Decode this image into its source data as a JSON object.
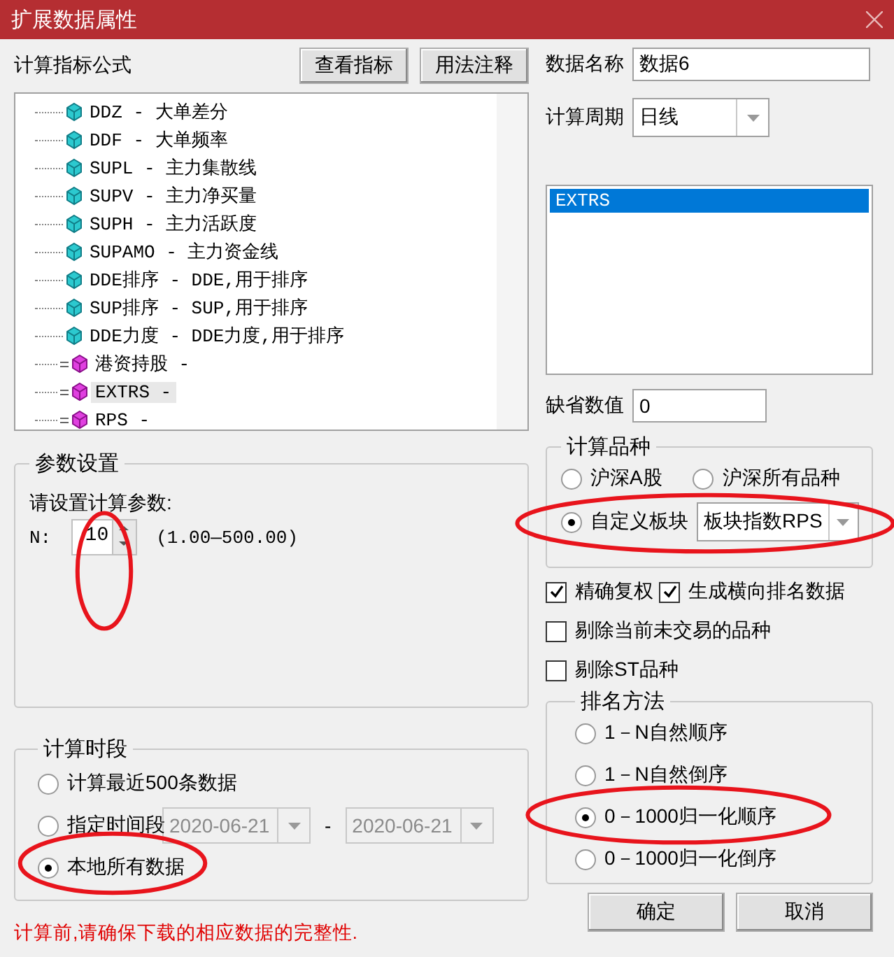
{
  "window": {
    "title": "扩展数据属性"
  },
  "formula": {
    "label": "计算指标公式",
    "buttons": [
      "查看指标",
      "用法注释"
    ],
    "tree": [
      {
        "kind": "formula",
        "text": "DDZ - 大单差分",
        "selected": false
      },
      {
        "kind": "formula",
        "text": "DDF - 大单频率",
        "selected": false
      },
      {
        "kind": "formula",
        "text": "SUPL - 主力集散线",
        "selected": false
      },
      {
        "kind": "formula",
        "text": "SUPV - 主力净买量",
        "selected": false
      },
      {
        "kind": "formula",
        "text": "SUPH - 主力活跃度",
        "selected": false
      },
      {
        "kind": "formula",
        "text": "SUPAMO - 主力资金线",
        "selected": false
      },
      {
        "kind": "formula",
        "text": "DDE排序 - DDE,用于排序",
        "selected": false
      },
      {
        "kind": "formula",
        "text": "SUP排序 - SUP,用于排序",
        "selected": false
      },
      {
        "kind": "formula",
        "text": "DDE力度 - DDE力度,用于排序",
        "selected": false
      },
      {
        "kind": "extended",
        "text": "港资持股 -",
        "selected": false
      },
      {
        "kind": "extended",
        "text": "EXTRS -",
        "selected": true
      },
      {
        "kind": "extended",
        "text": "RPS -",
        "selected": false
      }
    ]
  },
  "params": {
    "title": "参数设置",
    "prompt": "请设置计算参数:",
    "name": "N:",
    "value": "10",
    "range": "(1.00—500.00)",
    "circled": true
  },
  "period_range": {
    "title": "计算时段",
    "options": [
      {
        "kind": "plain",
        "label": "计算最近500条数据",
        "selected": false,
        "circled": false
      },
      {
        "kind": "range",
        "label": "指定时间段",
        "selected": false,
        "circled": false,
        "from": "2020-06-21",
        "separator": "-",
        "to": "2020-06-21",
        "disabled": true
      },
      {
        "kind": "plain",
        "label": "本地所有数据",
        "selected": true,
        "circled": true
      }
    ]
  },
  "note": "计算前,请确保下载的相应数据的完整性.",
  "data_name": {
    "label": "数据名称",
    "value": "数据6"
  },
  "period": {
    "label": "计算周期",
    "value": "日线"
  },
  "output_list": [
    {
      "text": "EXTRS",
      "selected": true
    }
  ],
  "default_value": {
    "label": "缺省数值",
    "value": "0"
  },
  "variety": {
    "title": "计算品种",
    "options": [
      {
        "label": "沪深A股",
        "selected": false,
        "circled": false
      },
      {
        "label": "沪深所有品种",
        "selected": false,
        "circled": false
      },
      {
        "label": "自定义板块",
        "selected": true,
        "circled": true,
        "dropdown": "板块指数RPS"
      }
    ]
  },
  "checks": [
    {
      "label": "精确复权",
      "checked": true
    },
    {
      "label": "生成横向排名数据",
      "checked": true
    },
    {
      "label": "剔除当前未交易的品种",
      "checked": false
    },
    {
      "label": "剔除ST品种",
      "checked": false
    }
  ],
  "ranking": {
    "title": "排名方法",
    "options": [
      {
        "label": "1－N自然顺序",
        "selected": false,
        "circled": false
      },
      {
        "label": "1－N自然倒序",
        "selected": false,
        "circled": false
      },
      {
        "label": "0－1000归一化顺序",
        "selected": true,
        "circled": true
      },
      {
        "label": "0－1000归一化倒序",
        "selected": false,
        "circled": false
      }
    ]
  },
  "buttons": [
    "确定",
    "取消"
  ]
}
